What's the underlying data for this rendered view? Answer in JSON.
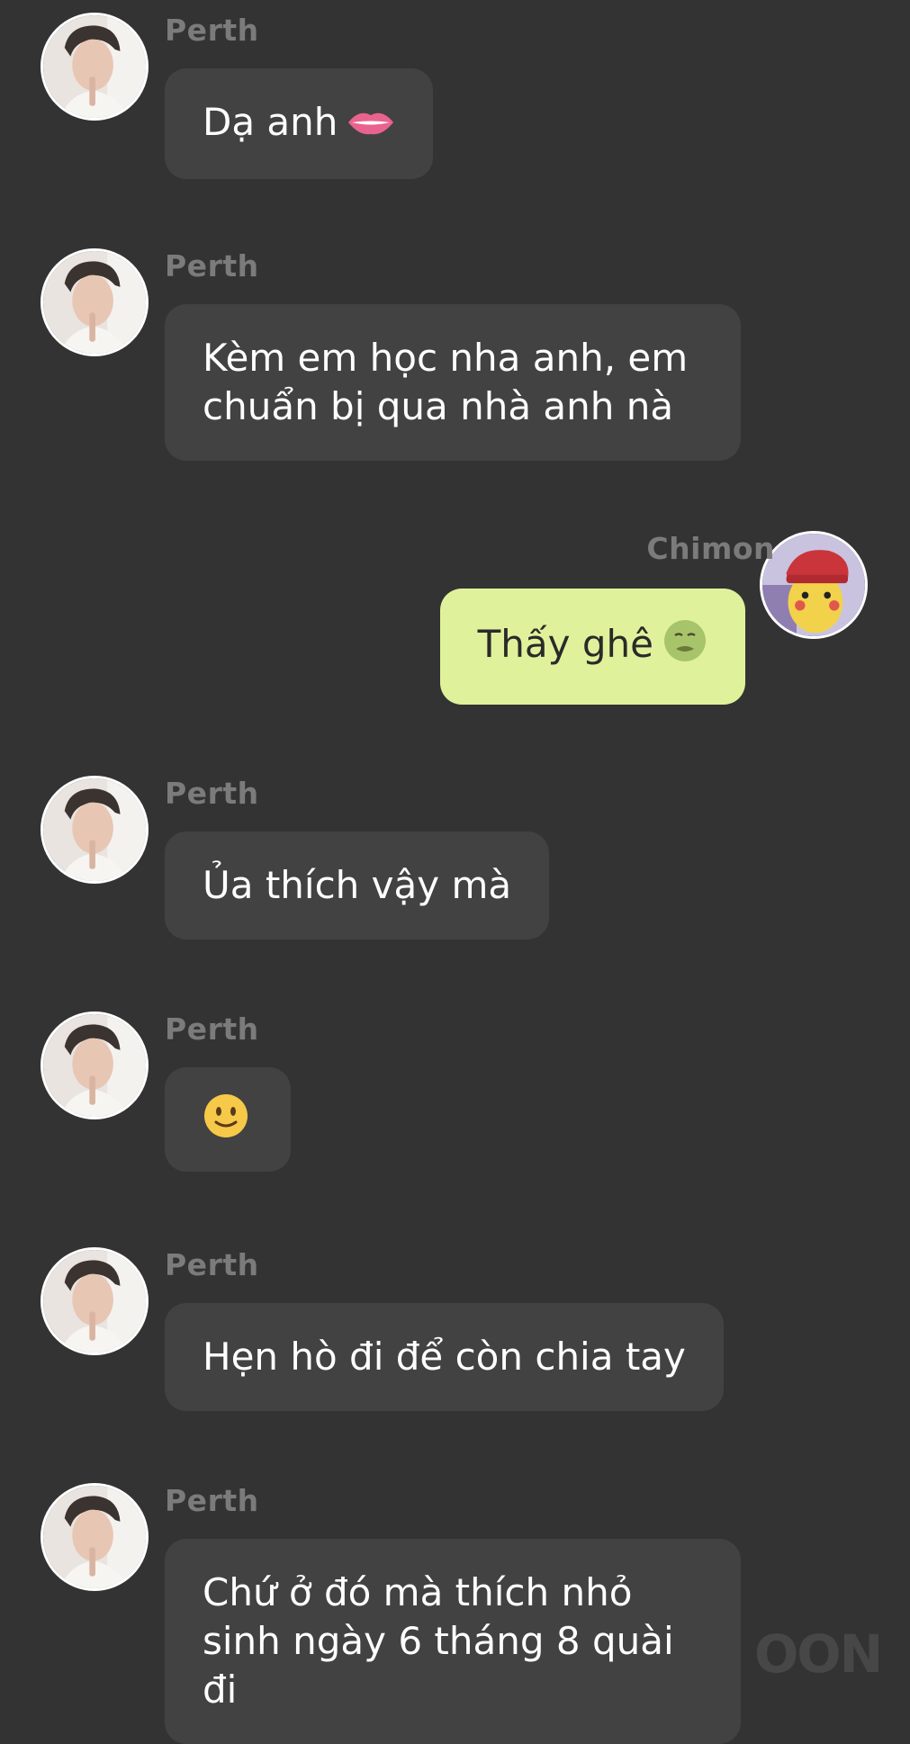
{
  "messages": [
    {
      "sender": "Perth",
      "text": "Dạ anh"
    },
    {
      "sender": "Perth",
      "text": "Kèm em học nha anh, em chuẩn bị qua nhà anh nà"
    },
    {
      "sender": "Chimon",
      "text": "Thấy ghê"
    },
    {
      "sender": "Perth",
      "text": "Ủa thích vậy mà"
    },
    {
      "sender": "Perth",
      "text": ""
    },
    {
      "sender": "Perth",
      "text": "Hẹn hò đi để còn chia tay"
    },
    {
      "sender": "Perth",
      "text": "Chứ ở đó mà thích nhỏ sinh ngày 6 tháng 8 quài đi"
    }
  ],
  "icons": [
    "avatar-perth",
    "avatar-chimon",
    "lips-emoji",
    "nauseated-emoji",
    "slight-smile-emoji"
  ],
  "colors": {
    "background": "#333333",
    "incoming_bubble": "#424242",
    "outgoing_bubble": "#dff29b",
    "sender_name": "#7b7b7b"
  },
  "watermark": "OON"
}
